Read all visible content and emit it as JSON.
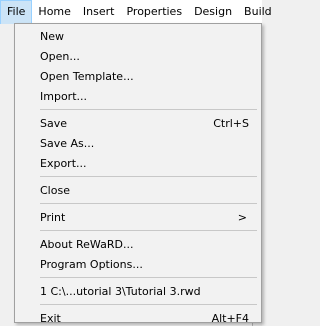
{
  "menubar": {
    "items": [
      {
        "label": "File"
      },
      {
        "label": "Home"
      },
      {
        "label": "Insert"
      },
      {
        "label": "Properties"
      },
      {
        "label": "Design"
      },
      {
        "label": "Build"
      }
    ]
  },
  "file_menu": {
    "new": "New",
    "open": "Open...",
    "open_template": "Open Template...",
    "import": "Import...",
    "save": "Save",
    "save_shortcut": "Ctrl+S",
    "save_as": "Save As...",
    "export": "Export...",
    "close": "Close",
    "print": "Print",
    "print_arrow": ">",
    "about": "About ReWaRD...",
    "program_options": "Program Options...",
    "recent_file": "1 C:\\...utorial 3\\Tutorial 3.rwd",
    "exit": "Exit",
    "exit_shortcut": "Alt+F4"
  }
}
